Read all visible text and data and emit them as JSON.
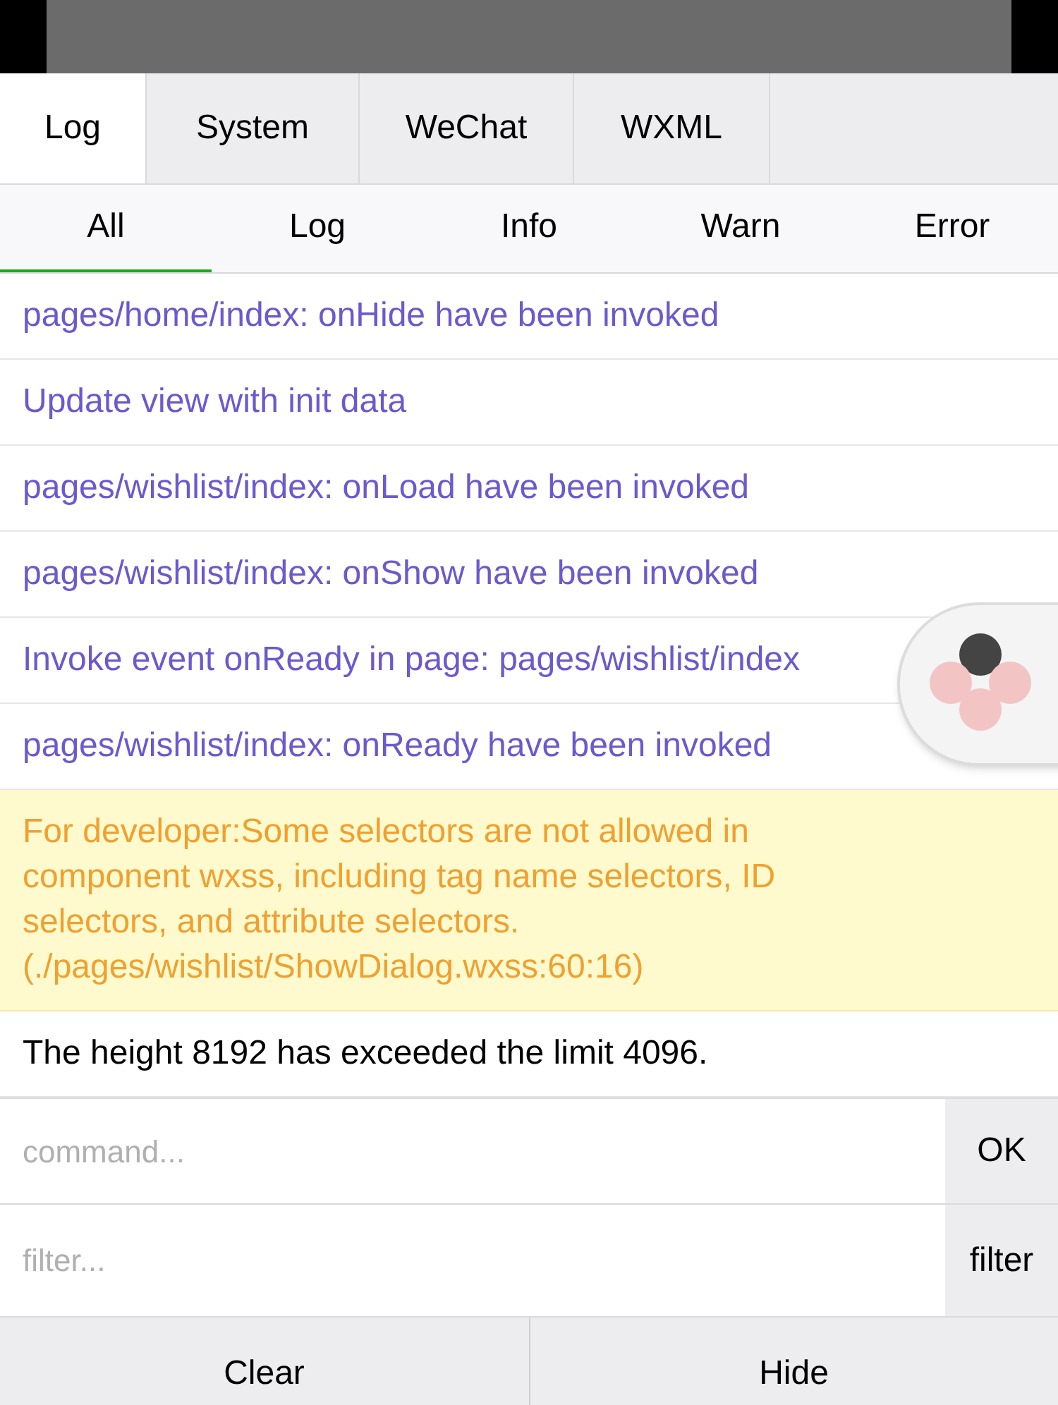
{
  "tabs": [
    {
      "label": "Log",
      "selected": true
    },
    {
      "label": "System",
      "selected": false
    },
    {
      "label": "WeChat",
      "selected": false
    },
    {
      "label": "WXML",
      "selected": false
    }
  ],
  "filters": [
    {
      "label": "All",
      "selected": true
    },
    {
      "label": "Log",
      "selected": false
    },
    {
      "label": "Info",
      "selected": false
    },
    {
      "label": "Warn",
      "selected": false
    },
    {
      "label": "Error",
      "selected": false
    }
  ],
  "log_entries": [
    {
      "kind": "info",
      "text": "pages/home/index: onHide have been invoked"
    },
    {
      "kind": "info",
      "text": "Update view with init data"
    },
    {
      "kind": "info",
      "text": "pages/wishlist/index: onLoad have been invoked"
    },
    {
      "kind": "info",
      "text": "pages/wishlist/index: onShow have been invoked"
    },
    {
      "kind": "info",
      "text": "Invoke event onReady in page: pages/wishlist/index"
    },
    {
      "kind": "info",
      "text": "pages/wishlist/index: onReady have been invoked"
    },
    {
      "kind": "warn",
      "text": "For developer:Some selectors are not allowed in component wxss, including tag name selectors, ID selectors, and attribute selectors.(./pages/wishlist/ShowDialog.wxss:60:16)"
    },
    {
      "kind": "log",
      "text": "The height 8192 has exceeded the limit 4096."
    }
  ],
  "command": {
    "placeholder": "command...",
    "button": "OK"
  },
  "filter": {
    "placeholder": "filter...",
    "button": "filter"
  },
  "footer": [
    "Clear",
    "Hide"
  ]
}
